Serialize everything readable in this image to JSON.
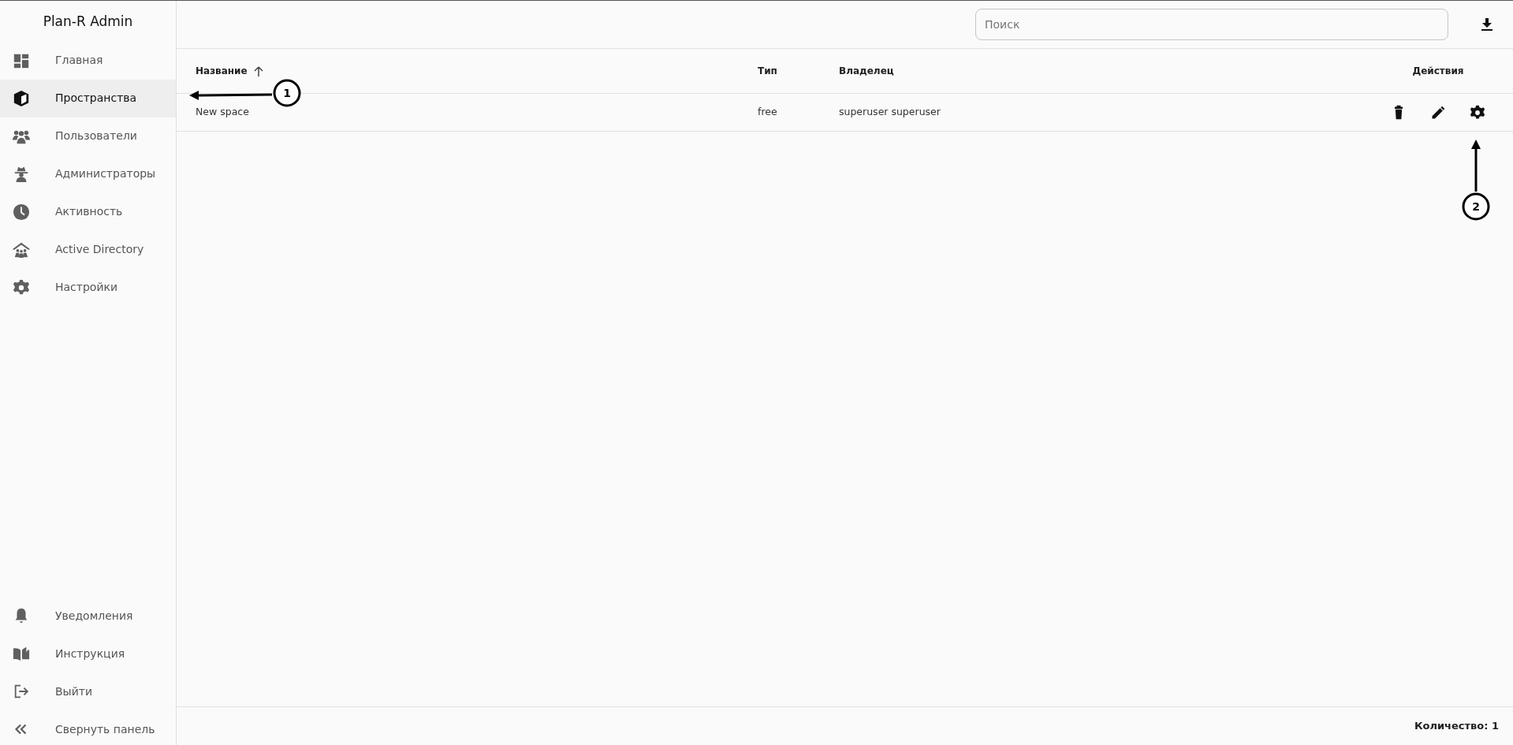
{
  "sidebar": {
    "title": "Plan-R Admin",
    "items": [
      {
        "label": "Главная",
        "selected": false
      },
      {
        "label": "Пространства",
        "selected": true
      },
      {
        "label": "Пользователи",
        "selected": false
      },
      {
        "label": "Администраторы",
        "selected": false
      },
      {
        "label": "Активность",
        "selected": false
      },
      {
        "label": "Active Directory",
        "selected": false
      },
      {
        "label": "Настройки",
        "selected": false
      }
    ],
    "bottom_items": [
      {
        "label": "Уведомления"
      },
      {
        "label": "Инструкция"
      },
      {
        "label": "Выйти"
      },
      {
        "label": "Свернуть панель"
      }
    ]
  },
  "search": {
    "placeholder": "Поиск"
  },
  "table": {
    "columns": [
      {
        "label": "Название",
        "sorted": true
      },
      {
        "label": "Тип"
      },
      {
        "label": "Владелец"
      },
      {
        "label": "Действия"
      }
    ],
    "rows": [
      {
        "name": "New space",
        "type": "free",
        "owner": "superuser superuser"
      }
    ]
  },
  "status_bar": {
    "count": "Количество: 1"
  },
  "annotations": [
    {
      "label": "1"
    },
    {
      "label": "2"
    }
  ]
}
